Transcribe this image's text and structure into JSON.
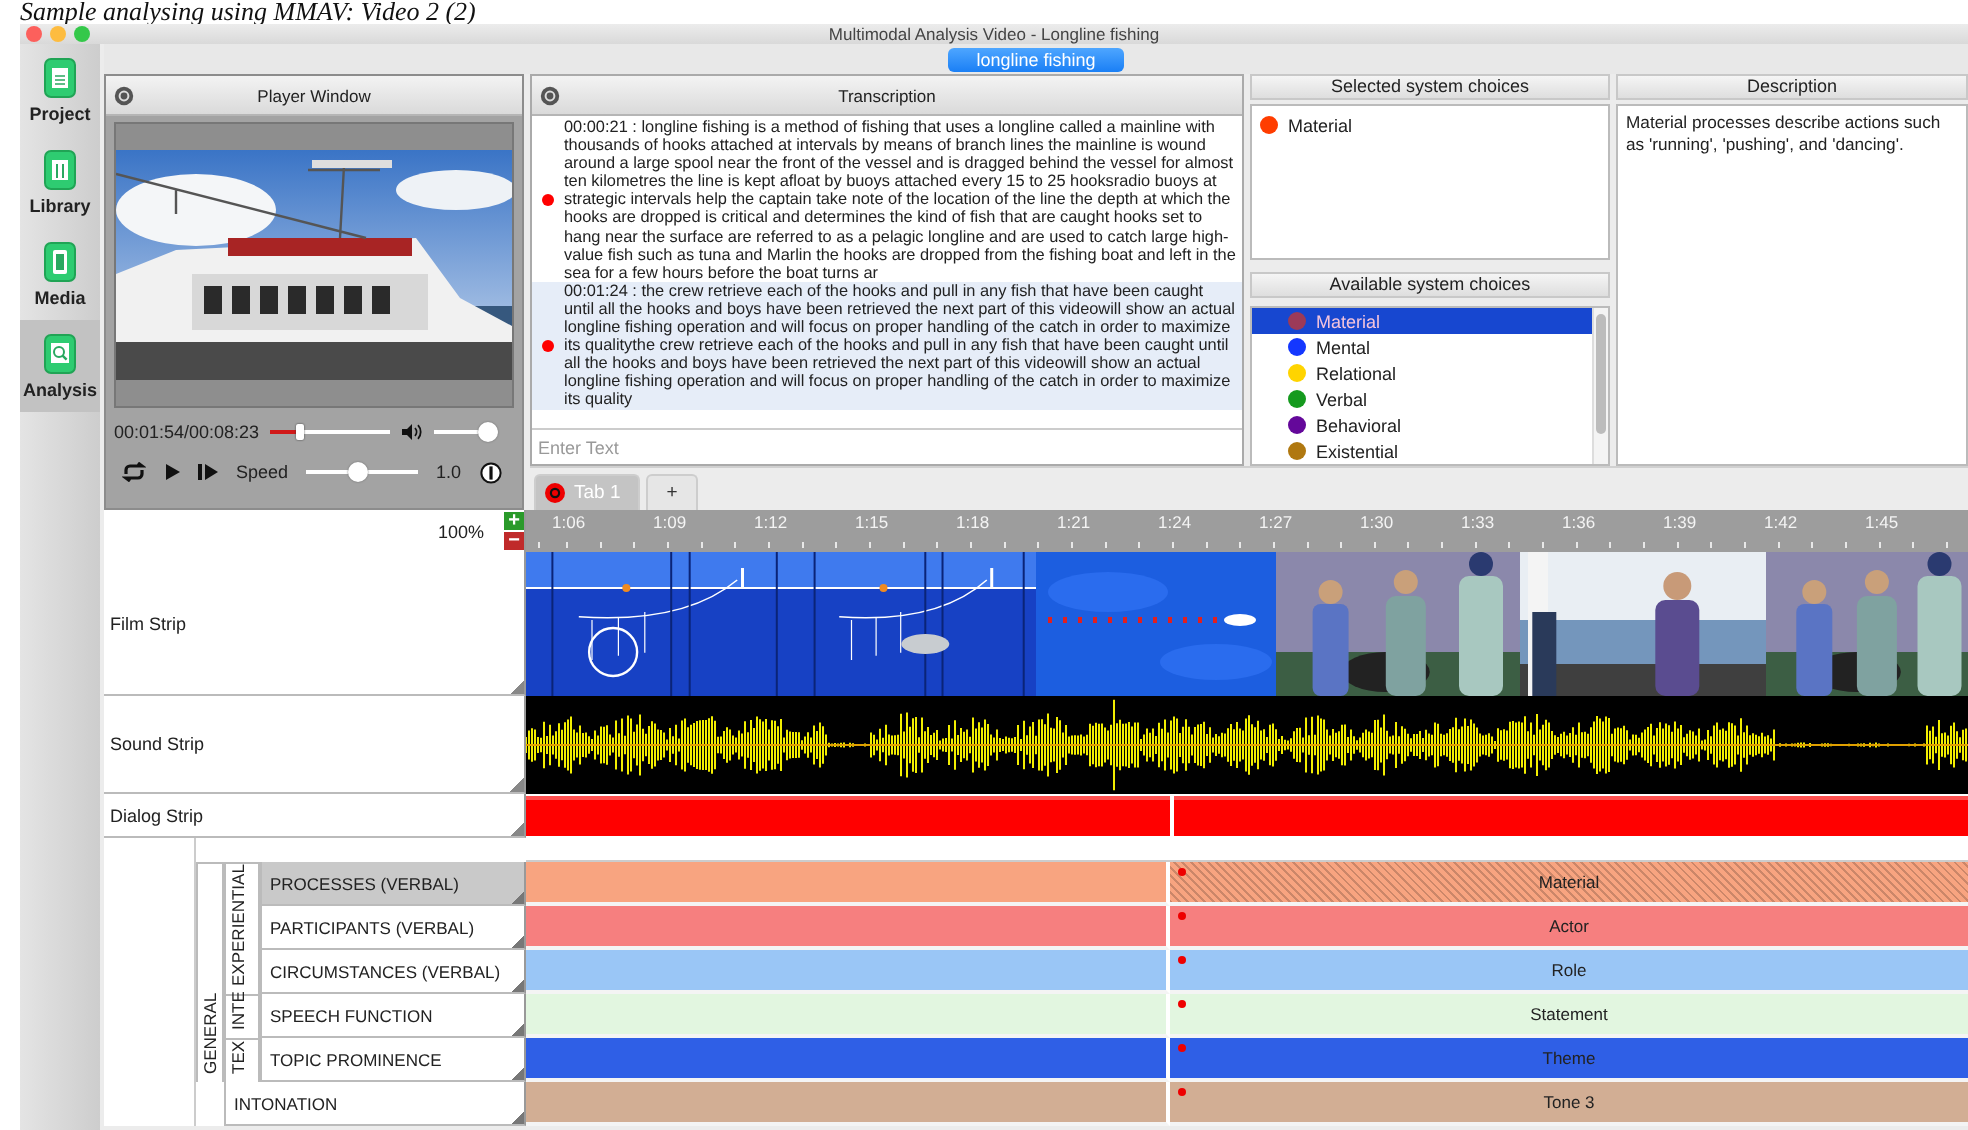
{
  "caption": "Sample analysing using MMAV: Video 2 (2)",
  "window": {
    "title": "Multimodal Analysis Video - Longline fishing"
  },
  "toolbar": {
    "button": "longline fishing"
  },
  "sidebar": {
    "items": [
      {
        "label": "Project",
        "selected": false
      },
      {
        "label": "Library",
        "selected": false
      },
      {
        "label": "Media",
        "selected": false
      },
      {
        "label": "Analysis",
        "selected": true
      }
    ]
  },
  "player": {
    "title": "Player Window",
    "time": "00:01:54/00:08:23",
    "seek": {
      "level": 0.24
    },
    "volume": {
      "level": 1
    },
    "speed_label": "Speed",
    "speed": {
      "level": 0.45
    },
    "speed_value": "1.0"
  },
  "transcription": {
    "title": "Transcription",
    "entries": [
      {
        "text": "00:00:21 : longline fishing is a method of fishing that uses a longline called a mainline with thousands of hooks attached at intervals by means of branch lines the mainline is wound around a large spool near the front of the vessel and is dragged behind the vessel for almost ten kilometres the line is kept afloat by buoys attached every 15 to 25 hooksradio buoys at strategic intervals help the captain take note of the location of the line the depth at which the hooks are dropped is critical and determines the kind of fish that are caught hooks set to hang near the surface are referred to as a pelagic longline and are used to catch large high-value fish such as tuna and Marlin the hooks are dropped from the fishing boat and left in the sea for a few hours before the boat turns ar",
        "selected": false
      },
      {
        "text": "00:01:24 : the crew retrieve each of the hooks and pull in any fish that have been caught until all the hooks and boys have been retrieved the next part of this videowill show an actual longline fishing operation and will focus on proper handling of the catch in order to maximize its qualitythe crew retrieve each of the hooks and pull in any fish that have been caught until all the hooks and boys have been retrieved the next part of this videowill show an actual longline fishing operation and will focus on proper handling of the catch in order to maximize its quality",
        "selected": true
      }
    ],
    "input": {
      "placeholder": "Enter Text"
    }
  },
  "selected_choices": {
    "title": "Selected system choices",
    "items": [
      {
        "label": "Material",
        "color": "#ff3d00"
      }
    ]
  },
  "available_choices": {
    "title": "Available system choices",
    "items": [
      {
        "label": "Material",
        "color": "#9c3a58",
        "selected": true
      },
      {
        "label": "Mental",
        "color": "#1437ff",
        "selected": false
      },
      {
        "label": "Relational",
        "color": "#ffd400",
        "selected": false
      },
      {
        "label": "Verbal",
        "color": "#159a1e",
        "selected": false
      },
      {
        "label": "Behavioral",
        "color": "#64089a",
        "selected": false
      },
      {
        "label": "Existential",
        "color": "#b07810",
        "selected": false
      }
    ]
  },
  "description": {
    "title": "Description",
    "text": "Material processes describe actions such as 'running', 'pushing', and 'dancing'."
  },
  "tabs": [
    {
      "label": "Tab 1",
      "selected": true
    },
    {
      "label": "+",
      "selected": false
    }
  ],
  "timeline": {
    "zoom": "100%",
    "zoom_in": "+",
    "zoom_out": "−",
    "ticks": [
      "1:06",
      "1:09",
      "1:12",
      "1:15",
      "1:18",
      "1:21",
      "1:24",
      "1:27",
      "1:30",
      "1:33",
      "1:36",
      "1:39",
      "1:42",
      "1:45"
    ]
  },
  "strips": [
    {
      "kind": "film",
      "label": "Film Strip"
    },
    {
      "kind": "sound",
      "label": "Sound Strip"
    },
    {
      "kind": "dialog",
      "label": "Dialog Strip"
    }
  ],
  "tiers": [
    {
      "label": "GENERAL",
      "children": [
        {
          "label": "EXPERIENTIAL",
          "children": [
            {
              "label": "PROCESSES (VERBAL)",
              "selected": true,
              "annotation": "Material",
              "color": "#f8a480"
            },
            {
              "label": "PARTICIPANTS (VERBAL)",
              "selected": false,
              "annotation": "Actor",
              "color": "#f67f7f"
            },
            {
              "label": "CIRCUMSTANCES (VERBAL)",
              "selected": false,
              "annotation": "Role",
              "color": "#9ac6f6"
            }
          ]
        },
        {
          "label": "INTE",
          "children": [
            {
              "label": "SPEECH FUNCTION",
              "selected": false,
              "annotation": "Statement",
              "color": "#e2f6e0"
            }
          ]
        },
        {
          "label": "TEX",
          "children": [
            {
              "label": "TOPIC PROMINENCE",
              "selected": false,
              "annotation": "Theme",
              "color": "#2f5fe6"
            }
          ]
        }
      ]
    },
    {
      "label": "INTONATION",
      "selected": false,
      "annotation": "Tone 3",
      "color": "#d2ae94"
    }
  ]
}
